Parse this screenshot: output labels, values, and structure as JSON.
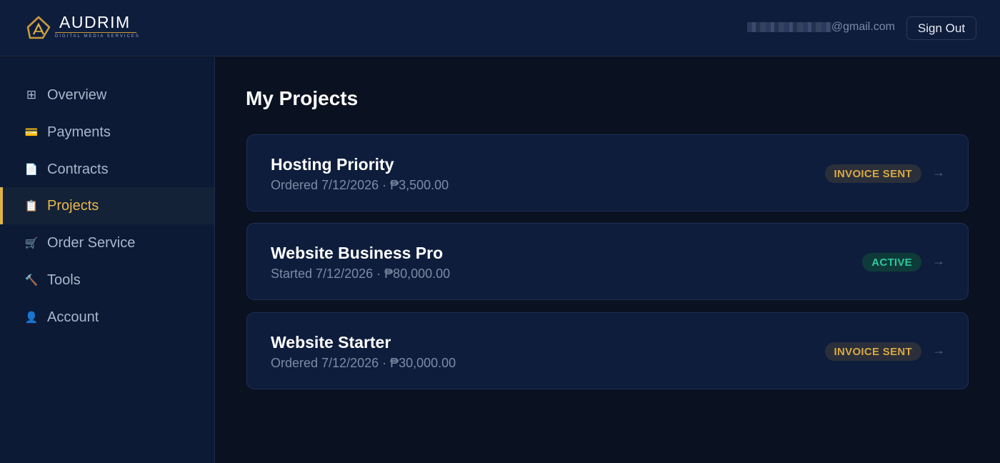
{
  "header": {
    "brand_name": "AUDRIM",
    "brand_tagline": "DIGITAL MEDIA SERVICES",
    "user_email_visible": "@gmail.com",
    "sign_out_label": "Sign Out"
  },
  "sidebar": {
    "items": [
      {
        "label": "Overview",
        "icon": "grid-icon",
        "glyph": "⊞",
        "active": false
      },
      {
        "label": "Payments",
        "icon": "credit-card-icon",
        "glyph": "💳",
        "active": false
      },
      {
        "label": "Contracts",
        "icon": "document-icon",
        "glyph": "📄",
        "active": false
      },
      {
        "label": "Projects",
        "icon": "clipboard-icon",
        "glyph": "📋",
        "active": true
      },
      {
        "label": "Order Service",
        "icon": "cart-icon",
        "glyph": "🛒",
        "active": false
      },
      {
        "label": "Tools",
        "icon": "hammer-icon",
        "glyph": "🔨",
        "active": false
      },
      {
        "label": "Account",
        "icon": "user-icon",
        "glyph": "👤",
        "active": false
      }
    ]
  },
  "main": {
    "title": "My Projects",
    "projects": [
      {
        "name": "Hosting Priority",
        "meta": "Ordered 7/12/2026 · ₱3,500.00",
        "status": "INVOICE SENT",
        "status_kind": "invoice",
        "arrow": "→"
      },
      {
        "name": "Website Business Pro",
        "meta": "Started 7/12/2026 · ₱80,000.00",
        "status": "ACTIVE",
        "status_kind": "active",
        "arrow": "→"
      },
      {
        "name": "Website Starter",
        "meta": "Ordered 7/12/2026 · ₱30,000.00",
        "status": "INVOICE SENT",
        "status_kind": "invoice",
        "arrow": "→"
      }
    ]
  },
  "colors": {
    "accent": "#e0b347",
    "background": "#0a1120",
    "panel": "#0e1d3c",
    "active_status": "#2ec79a",
    "invoice_status": "#d9a845"
  }
}
